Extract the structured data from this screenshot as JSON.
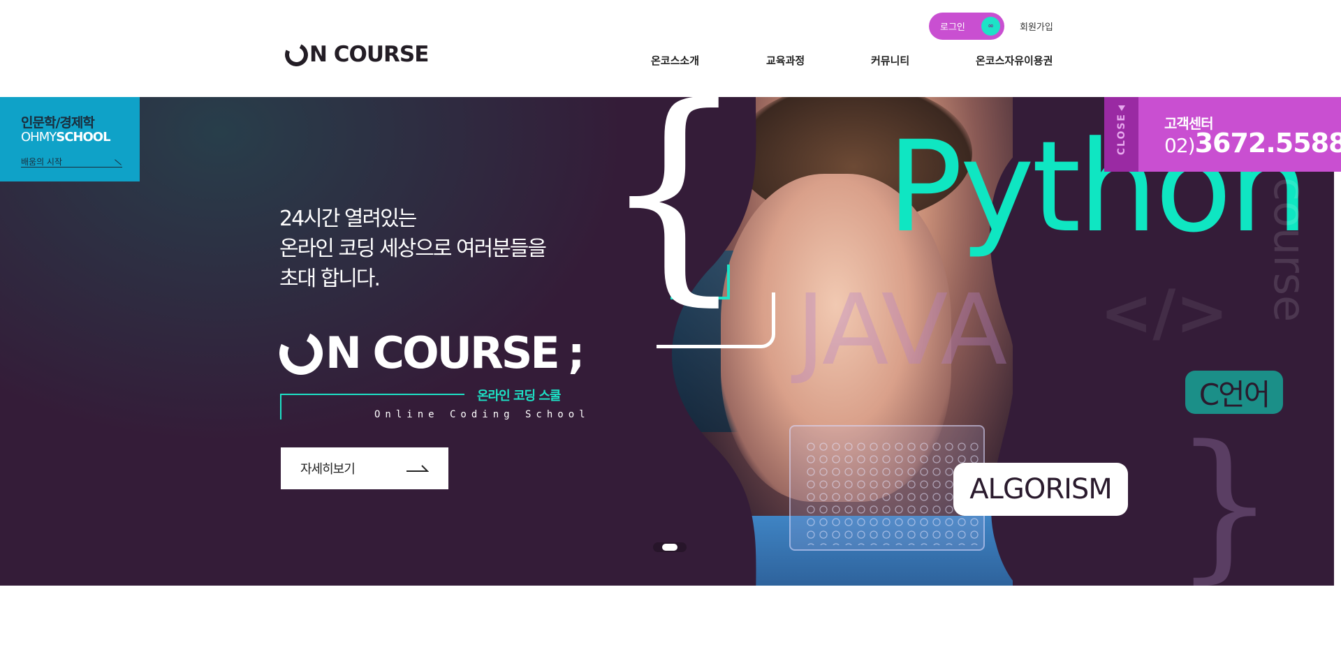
{
  "header": {
    "logo_text": "ON COURSE",
    "login_label": "로그인",
    "login_icon": "∞",
    "join_label": "회원가입",
    "nav": [
      "온코스소개",
      "교육과정",
      "커뮤니티",
      "온코스자유이용권"
    ]
  },
  "side_banner": {
    "title": "인문학/경제학",
    "brand_light": "OHMY",
    "brand_bold": "SCHOOL",
    "link": "배움의 시작"
  },
  "customer_center": {
    "close_label": "CLOSE",
    "label": "고객센터",
    "phone_prefix": "02)",
    "phone_number": "3672.5588"
  },
  "hero": {
    "lead_lines": [
      "24시간 열려있는",
      "온라인 코딩 세상으로 여러분들을",
      "초대 합니다."
    ],
    "logo_text": "N COURSE",
    "logo_semicolon": ";",
    "sub_korean": "온라인 코딩 스쿨",
    "sub_english": "Online Coding School",
    "more_button": "자세히보기",
    "decor": {
      "python": "Python",
      "java": "JAVA",
      "tag": "</>",
      "course": "course",
      "c_language": "C언어",
      "algorism": "ALGORISM"
    }
  },
  "colors": {
    "accent_teal": "#1de3c7",
    "accent_purple": "#c94fd1",
    "hero_bg": "#341c38",
    "side_banner_bg": "#0fa2c8"
  }
}
